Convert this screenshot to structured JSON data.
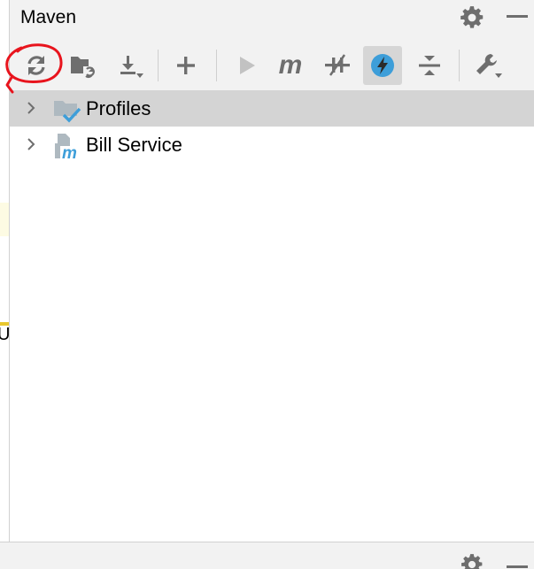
{
  "panel": {
    "title": "Maven"
  },
  "toolbar": {
    "buttons": [
      {
        "name": "reload-all-maven-projects",
        "icon": "refresh-icon",
        "active": false
      },
      {
        "name": "generate-sources-and-update-folders",
        "icon": "folder-refresh-icon",
        "active": false
      },
      {
        "name": "download-sources-and-documentation",
        "icon": "download-icon",
        "active": false
      },
      {
        "name": "add-maven-projects",
        "icon": "plus-icon",
        "active": false
      },
      {
        "name": "run-maven-build",
        "icon": "play-icon",
        "active": false
      },
      {
        "name": "execute-maven-goal",
        "icon": "maven-m-icon",
        "active": false
      },
      {
        "name": "toggle-offline-mode",
        "icon": "offline-icon",
        "active": false
      },
      {
        "name": "toggle-skip-tests-mode",
        "icon": "lightning-icon",
        "active": true
      },
      {
        "name": "collapse-all",
        "icon": "collapse-all-icon",
        "active": false
      },
      {
        "name": "maven-settings",
        "icon": "wrench-icon",
        "active": false
      }
    ]
  },
  "tree": {
    "items": [
      {
        "label": "Profiles",
        "icon": "profiles-folder-icon",
        "selected": true
      },
      {
        "label": "Bill Service",
        "icon": "maven-module-icon",
        "selected": false
      }
    ]
  },
  "left_editor": {
    "partial_text": "U"
  },
  "colors": {
    "icon_gray": "#6e6e6e",
    "accent_blue": "#3d9ed9",
    "active_bg": "#d6d6d6",
    "selected_row": "#d4d4d4",
    "annotation_red": "#e8141d"
  }
}
